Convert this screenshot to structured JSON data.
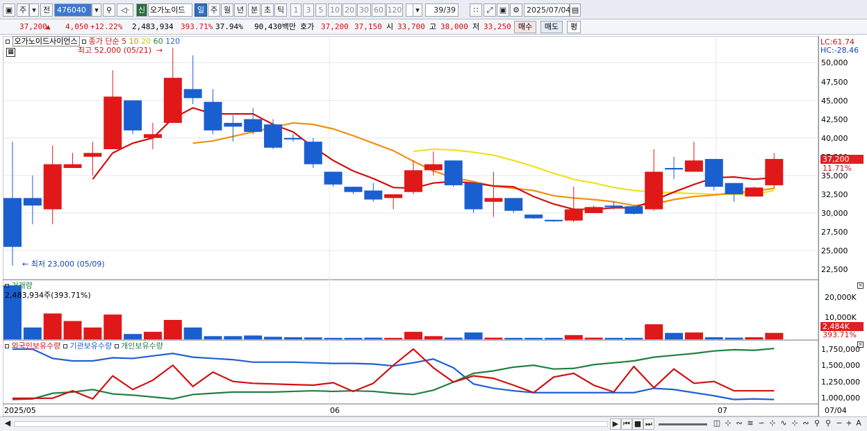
{
  "toolbar": {
    "mode_main": "주",
    "mode_prev": "전",
    "code": "476040",
    "badge": "신",
    "name": "오가노이드",
    "periods": [
      {
        "label": "일",
        "selected": true
      },
      {
        "label": "주",
        "selected": false
      },
      {
        "label": "월",
        "selected": false
      },
      {
        "label": "년",
        "selected": false
      },
      {
        "label": "분",
        "selected": false
      },
      {
        "label": "초",
        "selected": false
      },
      {
        "label": "틱",
        "selected": false
      }
    ],
    "minute_options": [
      "1",
      "3",
      "5",
      "10",
      "20",
      "30",
      "60",
      "120"
    ],
    "count": "39/39",
    "date": "2025/07/04"
  },
  "quote": {
    "price": "37,200",
    "change_arrow": "▲",
    "change": "4,050",
    "change_pct": "+12.22%",
    "volume": "2,483,934",
    "volume_pct": "393.71%",
    "turnover": "37.94%",
    "amount": "90,430백만",
    "ask_label": "호가",
    "ask": "37,200",
    "bid": "37,150",
    "open_label": "시",
    "open": "33,700",
    "high_label": "고",
    "high": "38,000",
    "low_label": "저",
    "low": "33,250",
    "sell_button": "매수",
    "buy_button": "매도",
    "eval_button": "평"
  },
  "legend": {
    "stock_name": "오가노이드사이언스",
    "ma_label": "종가 단순",
    "ma_periods": [
      "5",
      "10",
      "20",
      "60",
      "120"
    ],
    "ma_colors": [
      "#d01010",
      "#f08000",
      "#e8e000",
      "#208040",
      "#2060d0"
    ],
    "high_marker": "최고 52,000 (05/21)",
    "low_marker": "최저 23,000 (05/09)"
  },
  "right_axis": {
    "lc": "LC:61.74",
    "hc": "HC:-28.46",
    "price_ticks": [
      "50,000",
      "47,500",
      "45,000",
      "42,500",
      "40,000",
      "37,500",
      "35,000",
      "32,500",
      "30,000",
      "27,500",
      "25,000",
      "22,500"
    ],
    "price_tag": "37,200",
    "price_tag_pct": "11.71%",
    "volume_ticks": [
      "20,000K",
      "10,000K"
    ],
    "volume_tag": "2,484K",
    "volume_tag_pct": "393.71%",
    "holding_ticks": [
      "1,750,000",
      "1,500,000",
      "1,250,000",
      "1,000,000"
    ]
  },
  "volume_panel": {
    "title": "거래량",
    "value": "2,483,934주(393.71%)"
  },
  "holding_panel": {
    "series": [
      {
        "name": "외국인보유수량",
        "color": "#d01010"
      },
      {
        "name": "기관보유수량",
        "color": "#2060d0"
      },
      {
        "name": "개인보유수량",
        "color": "#208040"
      }
    ]
  },
  "x_axis": {
    "labels": [
      "2025/05",
      "06",
      "07"
    ],
    "end_label": "07/04"
  },
  "chart_data": {
    "type": "candlestick",
    "y_range": [
      21500,
      53000
    ],
    "candles": [
      {
        "o": 32000,
        "h": 39500,
        "l": 23000,
        "c": 25500
      },
      {
        "o": 32000,
        "h": 35000,
        "l": 28500,
        "c": 31000
      },
      {
        "o": 30500,
        "h": 39000,
        "l": 28500,
        "c": 36500
      },
      {
        "o": 36000,
        "h": 38000,
        "l": 36000,
        "c": 36500
      },
      {
        "o": 37500,
        "h": 39500,
        "l": 35000,
        "c": 38000
      },
      {
        "o": 38500,
        "h": 49000,
        "l": 38500,
        "c": 45500
      },
      {
        "o": 45000,
        "h": 45000,
        "l": 40500,
        "c": 41000
      },
      {
        "o": 40000,
        "h": 42000,
        "l": 38500,
        "c": 40500
      },
      {
        "o": 42000,
        "h": 52000,
        "l": 42000,
        "c": 48000
      },
      {
        "o": 46500,
        "h": 51000,
        "l": 44500,
        "c": 45300
      },
      {
        "o": 44800,
        "h": 46500,
        "l": 40500,
        "c": 41000
      },
      {
        "o": 42000,
        "h": 43000,
        "l": 39500,
        "c": 41500
      },
      {
        "o": 42500,
        "h": 44000,
        "l": 40500,
        "c": 40800
      },
      {
        "o": 41800,
        "h": 42500,
        "l": 38500,
        "c": 38700
      },
      {
        "o": 40000,
        "h": 40500,
        "l": 39500,
        "c": 39800
      },
      {
        "o": 39500,
        "h": 40000,
        "l": 36000,
        "c": 36500
      },
      {
        "o": 35500,
        "h": 35500,
        "l": 33500,
        "c": 33800
      },
      {
        "o": 33500,
        "h": 33500,
        "l": 32500,
        "c": 32800
      },
      {
        "o": 33000,
        "h": 34000,
        "l": 31500,
        "c": 31800
      },
      {
        "o": 32000,
        "h": 32500,
        "l": 30500,
        "c": 32500
      },
      {
        "o": 32800,
        "h": 37000,
        "l": 32500,
        "c": 35700
      },
      {
        "o": 35700,
        "h": 38200,
        "l": 35000,
        "c": 36500
      },
      {
        "o": 37000,
        "h": 37000,
        "l": 33500,
        "c": 33700
      },
      {
        "o": 34000,
        "h": 34000,
        "l": 30000,
        "c": 30500
      },
      {
        "o": 31500,
        "h": 35500,
        "l": 29500,
        "c": 32000
      },
      {
        "o": 32000,
        "h": 32000,
        "l": 30000,
        "c": 30300
      },
      {
        "o": 29800,
        "h": 29800,
        "l": 29200,
        "c": 29300
      },
      {
        "o": 29100,
        "h": 29100,
        "l": 28800,
        "c": 28900
      },
      {
        "o": 29000,
        "h": 33500,
        "l": 28800,
        "c": 30500
      },
      {
        "o": 30000,
        "h": 31000,
        "l": 30000,
        "c": 30800
      },
      {
        "o": 31000,
        "h": 31500,
        "l": 30500,
        "c": 30800
      },
      {
        "o": 30900,
        "h": 31000,
        "l": 29800,
        "c": 29900
      },
      {
        "o": 30500,
        "h": 38500,
        "l": 30300,
        "c": 35500
      },
      {
        "o": 36000,
        "h": 37500,
        "l": 34500,
        "c": 35800
      },
      {
        "o": 35500,
        "h": 39500,
        "l": 35500,
        "c": 37000
      },
      {
        "o": 37200,
        "h": 37200,
        "l": 33000,
        "c": 33500
      },
      {
        "o": 34000,
        "h": 34000,
        "l": 31500,
        "c": 32500
      },
      {
        "o": 32200,
        "h": 33500,
        "l": 32200,
        "c": 33400
      },
      {
        "o": 33700,
        "h": 38000,
        "l": 33250,
        "c": 37200
      }
    ],
    "ma5": [
      null,
      null,
      null,
      null,
      34500,
      38000,
      39300,
      40000,
      42600,
      44000,
      43200,
      43200,
      43200,
      41800,
      40800,
      38800,
      37000,
      35600,
      34600,
      33400,
      33300,
      34000,
      34200,
      34000,
      33600,
      33500,
      32200,
      31200,
      30500,
      30500,
      30700,
      30700,
      31700,
      32800,
      33800,
      34700,
      34800,
      34500,
      34700
    ],
    "ma10": [
      null,
      null,
      null,
      null,
      null,
      null,
      null,
      null,
      null,
      39300,
      39600,
      40200,
      40800,
      41400,
      42000,
      41800,
      41200,
      40300,
      39300,
      38300,
      36900,
      35600,
      34700,
      34200,
      33600,
      33300,
      33000,
      32300,
      32000,
      31800,
      31500,
      31000,
      31200,
      31800,
      32200,
      32400,
      32700,
      32900,
      33300
    ],
    "ma20": [
      null,
      null,
      null,
      null,
      null,
      null,
      null,
      null,
      null,
      null,
      null,
      null,
      null,
      null,
      null,
      null,
      null,
      null,
      null,
      null,
      38200,
      38500,
      38400,
      38100,
      37700,
      37000,
      36200,
      35300,
      34500,
      34000,
      33400,
      33000,
      32800,
      32700,
      32600,
      32500,
      32500,
      32500,
      33000
    ],
    "volume_max": 26000,
    "volume": [
      25000,
      5500,
      12000,
      8500,
      5500,
      11500,
      2500,
      3500,
      9000,
      5500,
      1500,
      1500,
      1800,
      1200,
      1000,
      900,
      700,
      700,
      800,
      700,
      3500,
      1500,
      800,
      3200,
      800,
      700,
      700,
      700,
      2000,
      800,
      700,
      700,
      7000,
      3000,
      3200,
      1000,
      800,
      1000,
      3000
    ],
    "holding_range": [
      880000,
      1850000
    ],
    "foreign": [
      960000,
      960000,
      960000,
      1080000,
      950000,
      1320000,
      1100000,
      1250000,
      1490000,
      1150000,
      1380000,
      1230000,
      1200000,
      1190000,
      1180000,
      1170000,
      1210000,
      1070000,
      1200000,
      1490000,
      1750000,
      1450000,
      1220000,
      1320000,
      1280000,
      1170000,
      1050000,
      1300000,
      1360000,
      1170000,
      1060000,
      1470000,
      1130000,
      1430000,
      1200000,
      1230000,
      1080000,
      1080000,
      1080000
    ],
    "institution": [
      1750000,
      1750000,
      1600000,
      1560000,
      1560000,
      1610000,
      1600000,
      1640000,
      1680000,
      1620000,
      1600000,
      1580000,
      1540000,
      1540000,
      1540000,
      1530000,
      1520000,
      1520000,
      1510000,
      1480000,
      1530000,
      1590000,
      1450000,
      1190000,
      1120000,
      1080000,
      1050000,
      1050000,
      1050000,
      1050000,
      1050000,
      1050000,
      1120000,
      1100000,
      1050000,
      1000000,
      940000,
      950000,
      940000
    ],
    "individual": [
      940000,
      950000,
      1040000,
      1060000,
      1100000,
      1030000,
      1010000,
      980000,
      950000,
      1020000,
      1040000,
      1060000,
      1060000,
      1060000,
      1070000,
      1080000,
      1070000,
      1080000,
      1070000,
      1040000,
      1020000,
      1090000,
      1220000,
      1360000,
      1400000,
      1460000,
      1490000,
      1430000,
      1440000,
      1500000,
      1530000,
      1560000,
      1620000,
      1650000,
      1680000,
      1720000,
      1740000,
      1730000,
      1760000
    ]
  }
}
